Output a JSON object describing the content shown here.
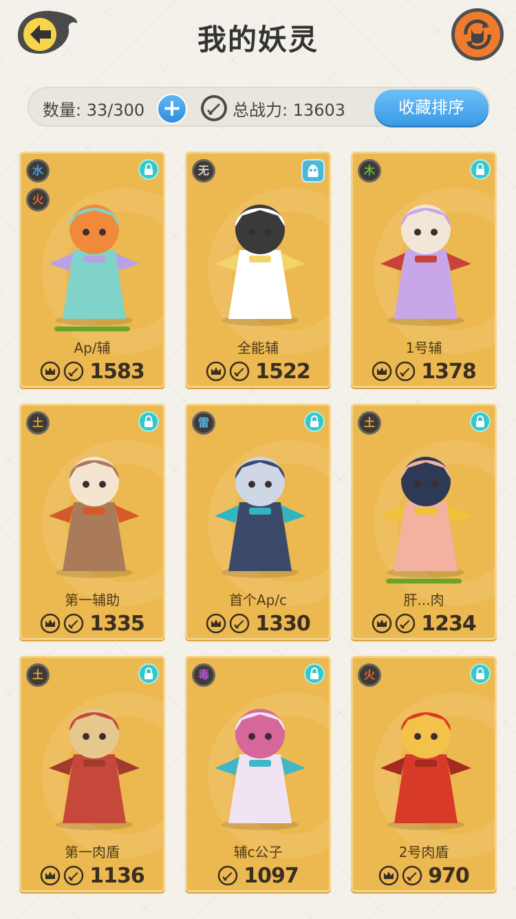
{
  "header": {
    "title": "我的妖灵"
  },
  "stats": {
    "count_label": "数量: 33/300",
    "add_label": "+",
    "power_label": "总战力: 13603",
    "sort_label": "收藏排序"
  },
  "colors": {
    "card_bg": "#ecb850",
    "accent_blue": "#3a9be6",
    "refresh_orange": "#f07a2d",
    "lock_teal": "#39c6c9"
  },
  "cards": [
    {
      "name": "Ap/辅",
      "power": "1583",
      "elements": [
        "水",
        "火"
      ],
      "element_colors": [
        "#3ea6e3",
        "#e7683c"
      ],
      "has_hp_bar": true,
      "hp": 1,
      "has_crown": true,
      "corner_icon": "lock-icon"
    },
    {
      "name": "全能辅",
      "power": "1522",
      "elements": [
        "无"
      ],
      "element_colors": [
        "#d7d3cc"
      ],
      "has_hp_bar": false,
      "has_crown": true,
      "corner_icon": "spirit-icon"
    },
    {
      "name": "1号辅",
      "power": "1378",
      "elements": [
        "木"
      ],
      "element_colors": [
        "#5fbf3b"
      ],
      "has_hp_bar": false,
      "has_crown": true,
      "corner_icon": "lock-icon"
    },
    {
      "name": "第一辅助",
      "power": "1335",
      "elements": [
        "土"
      ],
      "element_colors": [
        "#e6a23c"
      ],
      "has_hp_bar": false,
      "has_crown": true,
      "corner_icon": "lock-icon"
    },
    {
      "name": "首个Ap/c",
      "power": "1330",
      "elements": [
        "雷"
      ],
      "element_colors": [
        "#4fb4ea"
      ],
      "has_hp_bar": false,
      "has_crown": true,
      "corner_icon": "lock-icon"
    },
    {
      "name": "肝...肉",
      "power": "1234",
      "elements": [
        "土"
      ],
      "element_colors": [
        "#e6a23c"
      ],
      "has_hp_bar": true,
      "hp": 1,
      "has_crown": true,
      "corner_icon": "lock-icon"
    },
    {
      "name": "第一肉盾",
      "power": "1136",
      "elements": [
        "土"
      ],
      "element_colors": [
        "#e6a23c"
      ],
      "has_hp_bar": false,
      "has_crown": true,
      "corner_icon": "lock-icon"
    },
    {
      "name": "辅c公子",
      "power": "1097",
      "elements": [
        "毒"
      ],
      "element_colors": [
        "#b455d6"
      ],
      "has_hp_bar": false,
      "has_crown": false,
      "corner_icon": "lock-icon"
    },
    {
      "name": "2号肉盾",
      "power": "970",
      "elements": [
        "火"
      ],
      "element_colors": [
        "#e7683c"
      ],
      "has_hp_bar": false,
      "has_crown": true,
      "corner_icon": "lock-icon"
    }
  ]
}
